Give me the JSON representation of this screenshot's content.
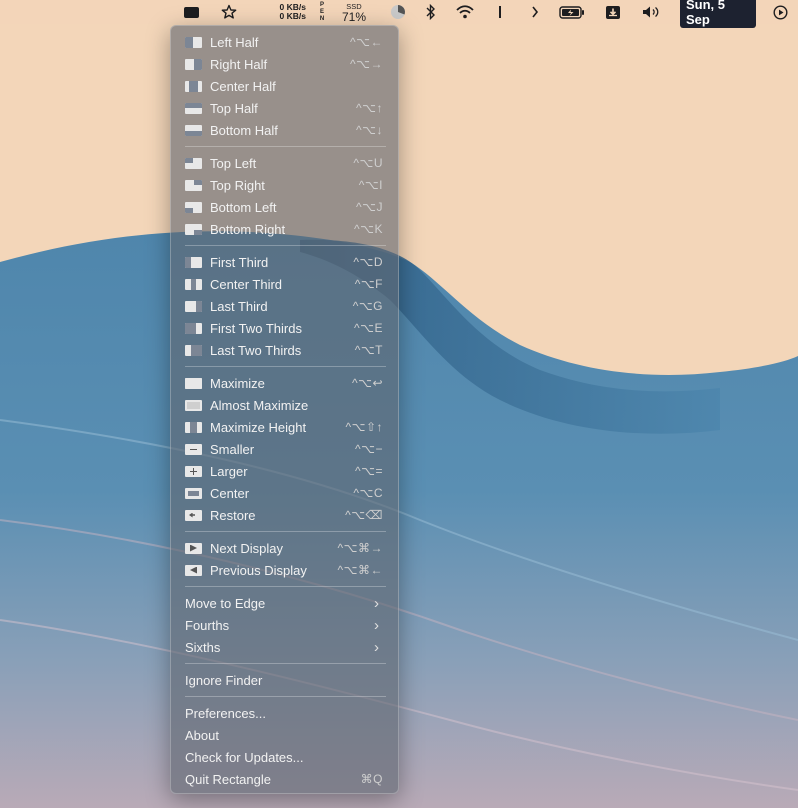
{
  "menubar": {
    "network": {
      "up": "0 KB/s",
      "down": "0 KB/s"
    },
    "pcore_label": [
      "P",
      "E",
      "N"
    ],
    "ssd": {
      "label": "SSD",
      "value": "71%"
    },
    "date": "Sun, 5 Sep"
  },
  "menu": {
    "group1": [
      {
        "label": "Left Half",
        "shortcut": "^⌥←",
        "icon": "left-half-icon"
      },
      {
        "label": "Right Half",
        "shortcut": "^⌥→",
        "icon": "right-half-icon"
      },
      {
        "label": "Center Half",
        "shortcut": "",
        "icon": "center-half-icon"
      },
      {
        "label": "Top Half",
        "shortcut": "^⌥↑",
        "icon": "top-half-icon"
      },
      {
        "label": "Bottom Half",
        "shortcut": "^⌥↓",
        "icon": "bottom-half-icon"
      }
    ],
    "group2": [
      {
        "label": "Top Left",
        "shortcut": "^⌥U",
        "icon": "top-left-icon"
      },
      {
        "label": "Top Right",
        "shortcut": "^⌥I",
        "icon": "top-right-icon"
      },
      {
        "label": "Bottom Left",
        "shortcut": "^⌥J",
        "icon": "bottom-left-icon"
      },
      {
        "label": "Bottom Right",
        "shortcut": "^⌥K",
        "icon": "bottom-right-icon"
      }
    ],
    "group3": [
      {
        "label": "First Third",
        "shortcut": "^⌥D",
        "icon": "first-third-icon"
      },
      {
        "label": "Center Third",
        "shortcut": "^⌥F",
        "icon": "center-third-icon"
      },
      {
        "label": "Last Third",
        "shortcut": "^⌥G",
        "icon": "last-third-icon"
      },
      {
        "label": "First Two Thirds",
        "shortcut": "^⌥E",
        "icon": "first-two-thirds-icon"
      },
      {
        "label": "Last Two Thirds",
        "shortcut": "^⌥T",
        "icon": "last-two-thirds-icon"
      }
    ],
    "group4": [
      {
        "label": "Maximize",
        "shortcut": "^⌥↩",
        "icon": "maximize-icon"
      },
      {
        "label": "Almost Maximize",
        "shortcut": "",
        "icon": "almost-maximize-icon"
      },
      {
        "label": "Maximize Height",
        "shortcut": "^⌥⇧↑",
        "icon": "maximize-height-icon"
      },
      {
        "label": "Smaller",
        "shortcut": "^⌥−",
        "icon": "smaller-icon"
      },
      {
        "label": "Larger",
        "shortcut": "^⌥=",
        "icon": "larger-icon"
      },
      {
        "label": "Center",
        "shortcut": "^⌥C",
        "icon": "center-icon"
      },
      {
        "label": "Restore",
        "shortcut": "^⌥⌫",
        "icon": "restore-icon"
      }
    ],
    "group5": [
      {
        "label": "Next Display",
        "shortcut": "^⌥⌘→",
        "icon": "next-display-icon"
      },
      {
        "label": "Previous Display",
        "shortcut": "^⌥⌘←",
        "icon": "previous-display-icon"
      }
    ],
    "submenus": [
      {
        "label": "Move to Edge"
      },
      {
        "label": "Fourths"
      },
      {
        "label": "Sixths"
      }
    ],
    "ignore": {
      "label": "Ignore Finder"
    },
    "app": [
      {
        "label": "Preferences...",
        "shortcut": ""
      },
      {
        "label": "About",
        "shortcut": ""
      },
      {
        "label": "Check for Updates...",
        "shortcut": ""
      },
      {
        "label": "Quit Rectangle",
        "shortcut": "⌘Q"
      }
    ]
  }
}
